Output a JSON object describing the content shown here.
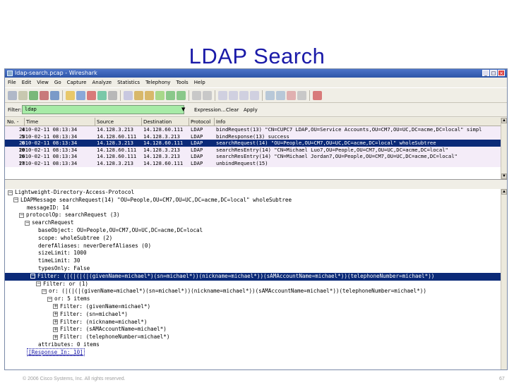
{
  "slide": {
    "title": "LDAP Search",
    "footer_left": "© 2006 Cisco Systems, Inc. All rights reserved.",
    "footer_right": "67"
  },
  "window": {
    "title": "ldap-search.pcap - Wireshark"
  },
  "menu": [
    "File",
    "Edit",
    "View",
    "Go",
    "Capture",
    "Analyze",
    "Statistics",
    "Telephony",
    "Tools",
    "Help"
  ],
  "filter": {
    "label": "Filter:",
    "value": "ldap",
    "expression_label": "Expression...",
    "clear_label": "Clear",
    "apply_label": "Apply"
  },
  "packet_list": {
    "columns": [
      "No. -",
      "Time",
      "Source",
      "Destination",
      "Protocol",
      "Info"
    ],
    "rows": [
      {
        "no": "4",
        "time": "2010-02-11 08:13:34",
        "src": "14.128.3.213",
        "dst": "14.128.60.111",
        "proto": "LDAP",
        "info": "bindRequest(13) \"CN=CUPC7 LDAP,OU=Service Accounts,OU=CM7,OU=UC,DC=acme,DC=local\" simpl",
        "selected": false
      },
      {
        "no": "5",
        "time": "2010-02-11 08:13:34",
        "src": "14.128.60.111",
        "dst": "14.128.3.213",
        "proto": "LDAP",
        "info": "bindResponse(13) success",
        "selected": false
      },
      {
        "no": "6",
        "time": "2010-02-11 08:13:34",
        "src": "14.128.3.213",
        "dst": "14.128.60.111",
        "proto": "LDAP",
        "info": "searchRequest(14) \"OU=People,OU=CM7,OU=UC,DC=acme,DC=local\" wholeSubtree",
        "selected": true
      },
      {
        "no": "10",
        "time": "2010-02-11 08:13:34",
        "src": "14.128.60.111",
        "dst": "14.128.3.213",
        "proto": "LDAP",
        "info": "searchResEntry(14) \"CN=Michael Luo7,OU=People,OU=CM7,OU=UC,DC=acme,DC=local\"",
        "selected": false
      },
      {
        "no": "16",
        "time": "2010-02-11 08:13:34",
        "src": "14.128.60.111",
        "dst": "14.128.3.213",
        "proto": "LDAP",
        "info": "searchResEntry(14) \"CN=Michael Jordan7,OU=People,OU=CM7,OU=UC,DC=acme,DC=local\"",
        "selected": false
      },
      {
        "no": "17",
        "time": "2010-02-11 08:13:34",
        "src": "14.128.3.213",
        "dst": "14.128.60.111",
        "proto": "LDAP",
        "info": "unbindRequest(15)",
        "selected": false
      }
    ]
  },
  "detail": {
    "rows": [
      {
        "indent": 0,
        "box": "-",
        "text": "Lightweight-Directory-Access-Protocol",
        "selected": false,
        "link": false
      },
      {
        "indent": 1,
        "box": "-",
        "text": "LDAPMessage searchRequest(14) \"OU=People,OU=CM7,OU=UC,DC=acme,DC=local\" wholeSubtree",
        "selected": false,
        "link": false
      },
      {
        "indent": 2,
        "box": "",
        "text": "messageID: 14",
        "selected": false,
        "link": false
      },
      {
        "indent": 2,
        "box": "-",
        "text": "protocolOp: searchRequest (3)",
        "selected": false,
        "link": false
      },
      {
        "indent": 3,
        "box": "-",
        "text": "searchRequest",
        "selected": false,
        "link": false
      },
      {
        "indent": 4,
        "box": "",
        "text": "baseObject: OU=People,OU=CM7,OU=UC,DC=acme,DC=local",
        "selected": false,
        "link": false
      },
      {
        "indent": 4,
        "box": "",
        "text": "scope: wholeSubtree (2)",
        "selected": false,
        "link": false
      },
      {
        "indent": 4,
        "box": "",
        "text": "derefAliases: neverDerefAliases (0)",
        "selected": false,
        "link": false
      },
      {
        "indent": 4,
        "box": "",
        "text": "sizeLimit: 1000",
        "selected": false,
        "link": false
      },
      {
        "indent": 4,
        "box": "",
        "text": "timeLimit: 30",
        "selected": false,
        "link": false
      },
      {
        "indent": 4,
        "box": "",
        "text": "typesOnly: False",
        "selected": false,
        "link": false
      },
      {
        "indent": 4,
        "box": "-",
        "text": "Filter: (|(|(|(|(givenName=michael*)(sn=michael*))(nickname=michael*))(sAMAccountName=michael*))(telephoneNumber=michael*))",
        "selected": true,
        "link": false
      },
      {
        "indent": 5,
        "box": "-",
        "text": "Filter: or (1)",
        "selected": false,
        "link": false
      },
      {
        "indent": 6,
        "box": "-",
        "text": "or: (|(|(|(givenName=michael*)(sn=michael*))(nickname=michael*))(sAMAccountName=michael*))(telephoneNumber=michael*))",
        "selected": false,
        "link": false
      },
      {
        "indent": 7,
        "box": "-",
        "text": "or: 5 items",
        "selected": false,
        "link": false
      },
      {
        "indent": 8,
        "box": "+",
        "text": "Filter: (givenName=michael*)",
        "selected": false,
        "link": false
      },
      {
        "indent": 8,
        "box": "+",
        "text": "Filter: (sn=michael*)",
        "selected": false,
        "link": false
      },
      {
        "indent": 8,
        "box": "+",
        "text": "Filter: (nickname=michael*)",
        "selected": false,
        "link": false
      },
      {
        "indent": 8,
        "box": "+",
        "text": "Filter: (sAMAccountName=michael*)",
        "selected": false,
        "link": false
      },
      {
        "indent": 8,
        "box": "+",
        "text": "Filter: (telephoneNumber=michael*)",
        "selected": false,
        "link": false
      },
      {
        "indent": 4,
        "box": "",
        "text": "attributes: 0 items",
        "selected": false,
        "link": false
      },
      {
        "indent": 2,
        "box": "",
        "text": "[Response In: 10]",
        "selected": false,
        "link": true
      }
    ]
  },
  "colors": {
    "title": "#1a1aa8",
    "selected_row": "#0b2a78",
    "filter_ok": "#a7eba7",
    "packet_row_bg": "#f4ecf8"
  }
}
